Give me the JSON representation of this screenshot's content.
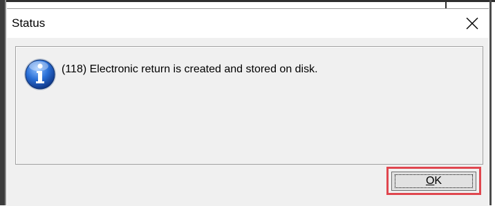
{
  "dialog": {
    "title": "Status",
    "message": "(118) Electronic return is created and stored on disk.",
    "ok_mnemonic": "O",
    "ok_rest": "K",
    "icon": "info-icon",
    "close_icon": "close-icon"
  },
  "colors": {
    "dialog_bg": "#f0f0f0",
    "highlight_border": "#e0464e",
    "info_icon_blue": "#1f5fc0"
  }
}
